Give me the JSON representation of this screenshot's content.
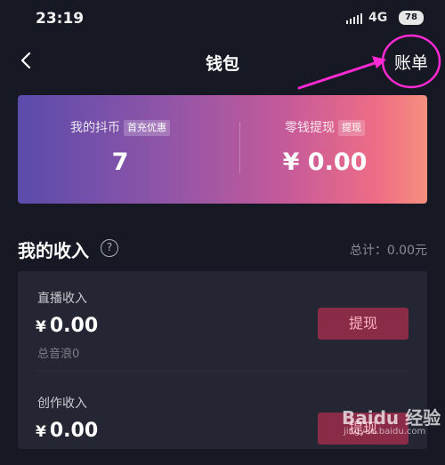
{
  "status_bar": {
    "time": "23:19",
    "network": "4G",
    "battery": "78"
  },
  "nav": {
    "title": "钱包",
    "bill_link": "账单"
  },
  "wallet_card": {
    "coins_label": "我的抖币",
    "coins_badge": "首充优惠",
    "coins_value": "7",
    "cash_label": "零钱提现",
    "cash_badge": "提现",
    "cash_value": "¥ 0.00"
  },
  "income": {
    "title": "我的收入",
    "help_icon": "?",
    "total": "总计：0.00元",
    "rows": [
      {
        "label": "直播收入",
        "currency": "¥",
        "amount": "0.00",
        "sub": "总音浪0",
        "button": "提现"
      },
      {
        "label": "创作收入",
        "currency": "¥",
        "amount": "0.00",
        "button": "提现"
      }
    ]
  },
  "watermark": {
    "main": "Baidu 经验",
    "sub": "jingyan.baidu.com"
  },
  "colors": {
    "background": "#161823",
    "card_start": "#5a4bab",
    "card_end": "#f58f7e",
    "button": "#8a2b48",
    "annotation": "#ff2ad4"
  }
}
